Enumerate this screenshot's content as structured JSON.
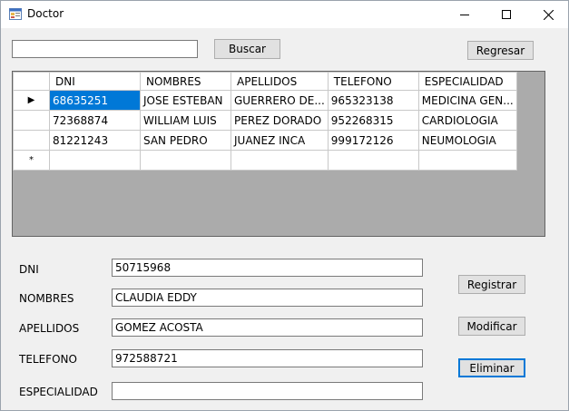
{
  "window": {
    "title": "Doctor",
    "icons": {
      "app": "form-icon",
      "minimize": "minimize-icon",
      "maximize": "maximize-icon",
      "close": "close-icon"
    }
  },
  "toolbar": {
    "search_value": "",
    "search_label": "Buscar",
    "back_label": "Regresar"
  },
  "grid": {
    "columns": [
      "DNI",
      "NOMBRES",
      "APELLIDOS",
      "TELEFONO",
      "ESPECIALIDAD"
    ],
    "rows": [
      {
        "marker": "▶",
        "cells": [
          "68635251",
          "JOSE ESTEBAN",
          "GUERRERO DE...",
          "965323138",
          "MEDICINA GEN..."
        ]
      },
      {
        "marker": "",
        "cells": [
          "72368874",
          "WILLIAM LUIS",
          "PEREZ DORADO",
          "952268315",
          "CARDIOLOGIA"
        ]
      },
      {
        "marker": "",
        "cells": [
          "81221243",
          "SAN PEDRO",
          "JUANEZ INCA",
          "999172126",
          "NEUMOLOGIA"
        ]
      }
    ],
    "new_row_marker": "*"
  },
  "form": {
    "dni_label": "DNI",
    "dni_value": "50715968",
    "nombres_label": "NOMBRES",
    "nombres_value": "CLAUDIA EDDY",
    "apellidos_label": "APELLIDOS",
    "apellidos_value": "GOMEZ ACOSTA",
    "telefono_label": "TELEFONO",
    "telefono_value": "972588721",
    "especialidad_label": "ESPECIALIDAD",
    "especialidad_value": ""
  },
  "actions": {
    "register_label": "Registrar",
    "modify_label": "Modificar",
    "delete_label": "Eliminar"
  },
  "colors": {
    "selection": "#0078d7",
    "grid_background": "#ababab",
    "window_background": "#f0f0f0"
  }
}
